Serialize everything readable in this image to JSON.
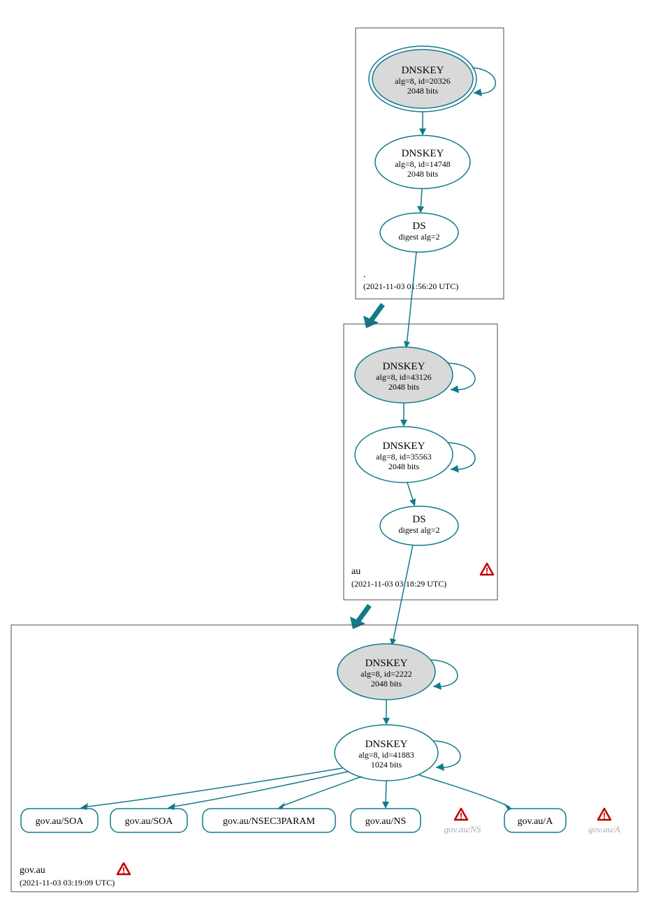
{
  "zones": {
    "root": {
      "label": ".",
      "timestamp": "(2021-11-03 01:56:20 UTC)",
      "nodes": {
        "ksk": {
          "title": "DNSKEY",
          "line1": "alg=8, id=20326",
          "line2": "2048 bits"
        },
        "zsk": {
          "title": "DNSKEY",
          "line1": "alg=8, id=14748",
          "line2": "2048 bits"
        },
        "ds": {
          "title": "DS",
          "line1": "digest alg=2"
        }
      }
    },
    "au": {
      "label": "au",
      "timestamp": "(2021-11-03 03:18:29 UTC)",
      "nodes": {
        "ksk": {
          "title": "DNSKEY",
          "line1": "alg=8, id=43126",
          "line2": "2048 bits"
        },
        "zsk": {
          "title": "DNSKEY",
          "line1": "alg=8, id=35563",
          "line2": "2048 bits"
        },
        "ds": {
          "title": "DS",
          "line1": "digest alg=2"
        }
      },
      "warning": true
    },
    "govau": {
      "label": "gov.au",
      "timestamp": "(2021-11-03 03:19:09 UTC)",
      "nodes": {
        "ksk": {
          "title": "DNSKEY",
          "line1": "alg=8, id=2222",
          "line2": "2048 bits"
        },
        "zsk": {
          "title": "DNSKEY",
          "line1": "alg=8, id=41883",
          "line2": "1024 bits"
        }
      },
      "rrsets": {
        "soa1": "gov.au/SOA",
        "soa2": "gov.au/SOA",
        "nsec3param": "gov.au/NSEC3PARAM",
        "ns": "gov.au/NS",
        "ns_warn": "gov.au/NS",
        "a": "gov.au/A",
        "a_warn": "gov.au/A"
      },
      "warning": true
    }
  }
}
